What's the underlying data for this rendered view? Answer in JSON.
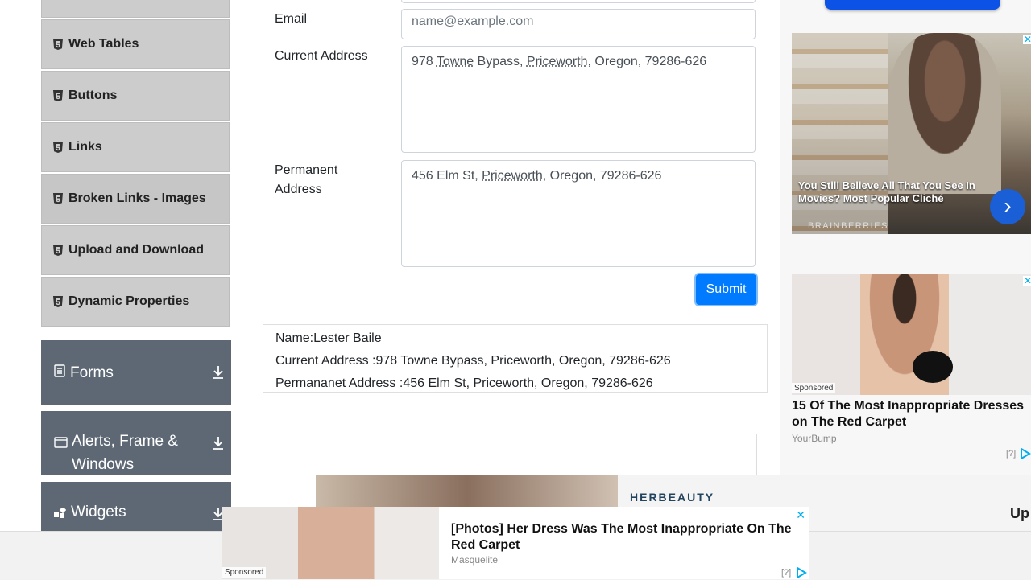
{
  "sidebar": {
    "items": [
      {
        "label": "Web Tables"
      },
      {
        "label": "Buttons"
      },
      {
        "label": "Links"
      },
      {
        "label": "Broken Links - Images"
      },
      {
        "label": "Upload and Download"
      },
      {
        "label": "Dynamic Properties"
      }
    ],
    "groups": [
      {
        "label": "Forms"
      },
      {
        "label": "Alerts, Frame & Windows"
      },
      {
        "label": "Widgets"
      }
    ]
  },
  "form": {
    "email_label": "Email",
    "email_placeholder": "name@example.com",
    "current_address_label": "Current Address",
    "current_address_value": {
      "p1": "978 ",
      "w1": "Towne",
      "p2": " Bypass, ",
      "w2": "Priceworth",
      "p3": ", Oregon, 79286-626"
    },
    "permanent_address_label_1": "Permanent",
    "permanent_address_label_2": "Address",
    "permanent_address_value": {
      "p1": "456 Elm St, ",
      "w1": "Priceworth",
      "p2": ", Oregon, 79286-626"
    },
    "submit_label": "Submit"
  },
  "output": {
    "name": "Name:Lester Baile",
    "current_address": "Current Address :978 Towne Bypass, Priceworth, Oregon, 79286-626",
    "permanent_address": "Permananet Address :456 Elm St, Priceworth, Oregon, 79286-626"
  },
  "ads": {
    "ad1": {
      "text": "You Still Believe All That You See In Movies? Most Popular Cliché",
      "brand": "BRAINBERRIES"
    },
    "ad2": {
      "sponsored": "Sponsored",
      "title": "15 Of The Most Inappropriate Dresses on The Red Carpet",
      "source": "YourBump",
      "q": "[?]"
    },
    "herb": {
      "brand": "HERBEAUTY",
      "up": "Up"
    },
    "bottom": {
      "sponsored": "Sponsored",
      "title": "[Photos] Her Dress Was The Most Inappropriate On The Red Carpet",
      "source": "Masquelite",
      "q": "[?]",
      "close": "✕"
    }
  }
}
